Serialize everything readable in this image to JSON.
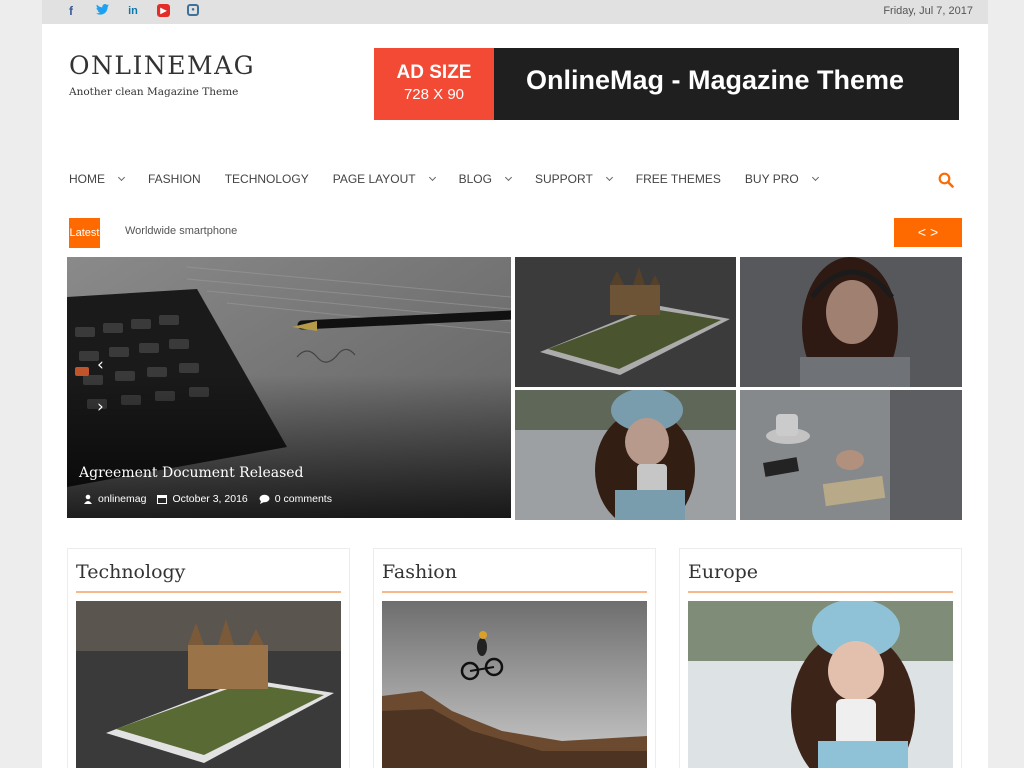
{
  "topbar": {
    "social_icons": [
      "facebook-icon",
      "twitter-icon",
      "linkedin-icon",
      "youtube-icon",
      "instagram-icon"
    ],
    "date": "Friday, Jul 7, 2017"
  },
  "header": {
    "logo": "ONLINEMAG",
    "tagline": "Another clean Magazine Theme",
    "ad": {
      "size_label": "AD SIZE",
      "dimensions": "728 X 90",
      "text": "OnlineMag - Magazine Theme"
    }
  },
  "nav": {
    "items": [
      {
        "label": "HOME",
        "has_dropdown": true
      },
      {
        "label": "FASHION",
        "has_dropdown": false
      },
      {
        "label": "TECHNOLOGY",
        "has_dropdown": false
      },
      {
        "label": "PAGE LAYOUT",
        "has_dropdown": true
      },
      {
        "label": "BLOG",
        "has_dropdown": true
      },
      {
        "label": "SUPPORT",
        "has_dropdown": true
      },
      {
        "label": "FREE THEMES",
        "has_dropdown": false
      },
      {
        "label": "BUY PRO",
        "has_dropdown": true
      }
    ],
    "search_icon": "search-icon"
  },
  "ticker": {
    "badge": "Latest",
    "text": "Worldwide smartphone",
    "nav_label": "< >"
  },
  "featured": {
    "title": "Agreement Document Released",
    "author": "onlinemag",
    "date": "October 3, 2016",
    "comments": "0 comments"
  },
  "categories": [
    {
      "title": "Technology"
    },
    {
      "title": "Fashion"
    },
    {
      "title": "Europe"
    }
  ],
  "colors": {
    "accent": "#ff6a00",
    "ad_red": "#f24a34",
    "ad_dark": "#1f1f1f",
    "rule": "#f6b98c"
  }
}
